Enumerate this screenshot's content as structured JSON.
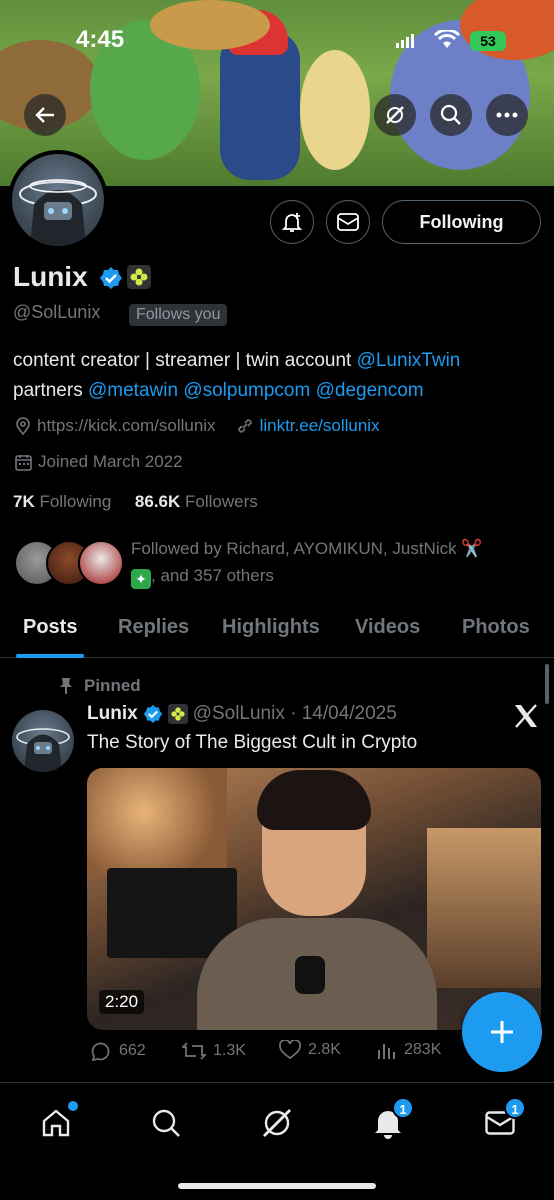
{
  "status_bar": {
    "time": "4:45",
    "battery": "53"
  },
  "profile": {
    "name": "Lunix",
    "handle": "@SolLunix",
    "follows_you": "Follows you",
    "bio_text": "content creator | streamer | twin account ",
    "bio_mention_1": "@LunixTwin",
    "bio_line2_prefix": "partners ",
    "bio_mention_2": "@metawin",
    "bio_mention_3": "@solpumpcom",
    "bio_mention_4": "@degencom",
    "website": "https://kick.com/sollunix",
    "link": "linktr.ee/sollunix",
    "joined": "Joined March 2022",
    "following_count": "7K",
    "following_label": "Following",
    "followers_count": "86.6K",
    "followers_label": "Followers",
    "followed_by_line1": "Followed by Richard, AYOMIKUN, JustNick ✂️",
    "followed_by_line2": ", and 357 others"
  },
  "actions": {
    "follow_label": "Following"
  },
  "tabs": [
    "Posts",
    "Replies",
    "Highlights",
    "Videos",
    "Photos"
  ],
  "pinned_post": {
    "pinned_label": "Pinned",
    "author": "Lunix",
    "handle_date": "@SolLunix · 14/04/2025",
    "text": "The Story of The Biggest Cult in Crypto",
    "video_duration": "2:20",
    "replies": "662",
    "reposts": "1.3K",
    "likes": "2.8K",
    "views": "283K"
  },
  "bottom_nav": {
    "notifications_badge": "1",
    "messages_badge": "1"
  },
  "colors": {
    "accent": "#1d9bf0",
    "background": "#000000",
    "muted": "#71767b",
    "battery": "#34c759"
  }
}
